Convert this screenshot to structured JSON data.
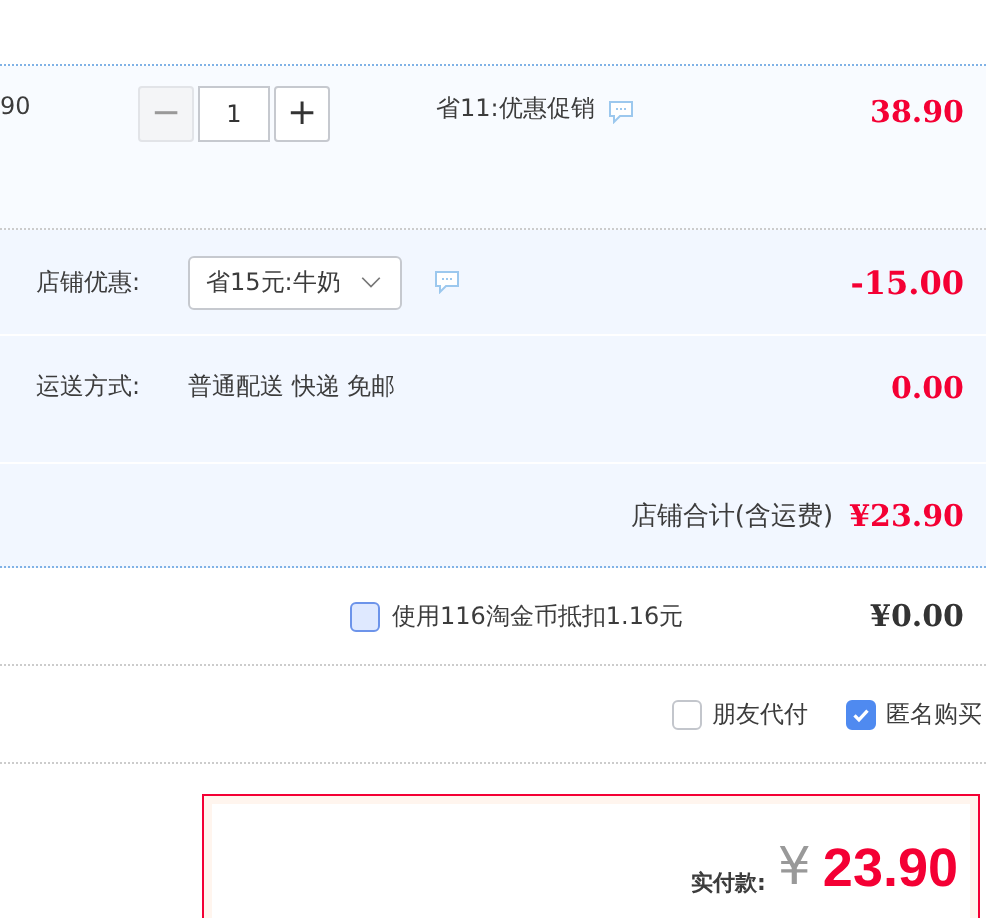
{
  "item": {
    "price_cut": "90",
    "quantity": {
      "value": "1",
      "minus": "−",
      "plus": "+",
      "minus_disabled": true
    },
    "promotion": "省11:优惠促销",
    "subtotal": "38.90"
  },
  "shop": {
    "discount": {
      "label": "店铺优惠:",
      "selected_option": "省15元:牛奶",
      "amount": "-15.00"
    },
    "shipping": {
      "label": "运送方式:",
      "method": "普通配送 快递 免邮",
      "amount": "0.00"
    },
    "total": {
      "label": "店铺合计(含运费)",
      "amount": "¥23.90"
    }
  },
  "coins": {
    "checked": false,
    "label": "使用116淘金币抵扣1.16元",
    "amount": "¥0.00"
  },
  "options": [
    {
      "label": "朋友代付",
      "checked": false
    },
    {
      "label": "匿名购买",
      "checked": true
    }
  ],
  "payment": {
    "label": "实付款:",
    "currency": "¥",
    "amount": "23.90"
  }
}
